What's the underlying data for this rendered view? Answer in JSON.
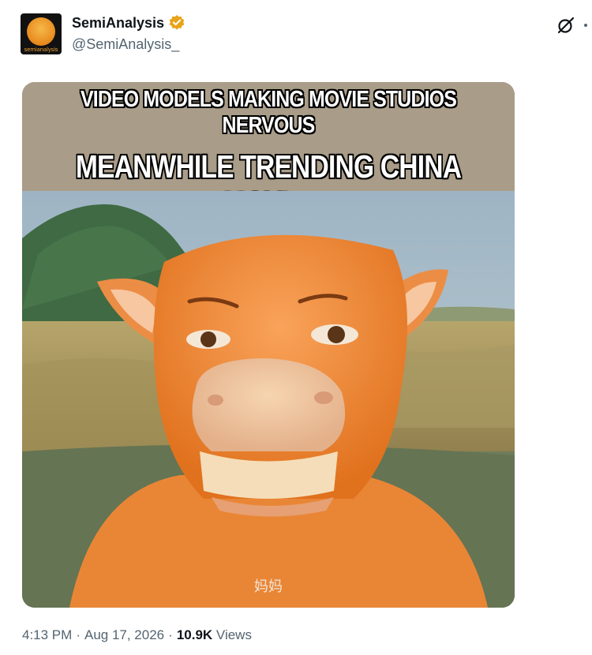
{
  "author": {
    "display_name": "SemiAnalysis",
    "handle": "@SemiAnalysis_",
    "avatar_text": "semianalysis",
    "verified": true
  },
  "media": {
    "caption_top": "VIDEO MODELS MAKING MOVIE STUDIOS NERVOUS",
    "caption_bottom": "MEANWHILE TRENDING CHINA MOVIE:",
    "subtitle": "妈妈"
  },
  "meta": {
    "time": "4:13 PM",
    "separator": "·",
    "date": "Aug 17, 2026",
    "views_count": "10.9K",
    "views_label": "Views"
  },
  "colors": {
    "verified_badge": "#e8a317",
    "caption_band": "#a99c88",
    "text_primary": "#0f1419",
    "text_secondary": "#536471"
  },
  "icons": [
    "verified-badge-icon",
    "grok-icon",
    "more-icon"
  ]
}
